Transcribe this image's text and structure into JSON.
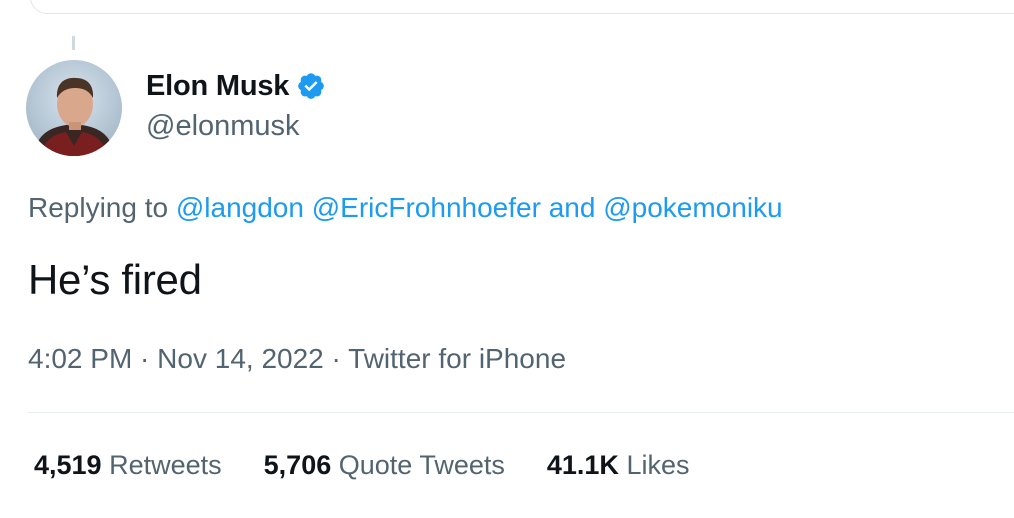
{
  "author": {
    "display_name": "Elon Musk",
    "handle": "@elonmusk",
    "verified": true
  },
  "reply_context": {
    "prefix": "Replying to ",
    "mentions": [
      "@langdon",
      "@EricFrohnhoefer",
      "@pokemoniku"
    ],
    "separator_space": " ",
    "conjunction": " and "
  },
  "tweet": {
    "text": "He’s fired"
  },
  "meta": {
    "time": "4:02 PM",
    "separator": " · ",
    "date": "Nov 14, 2022",
    "source": "Twitter for iPhone"
  },
  "stats": [
    {
      "count": "4,519",
      "label": "Retweets"
    },
    {
      "count": "5,706",
      "label": "Quote Tweets"
    },
    {
      "count": "41.1K",
      "label": "Likes"
    }
  ],
  "colors": {
    "accent": "#1d9bf0",
    "secondary_text": "#536471",
    "primary_text": "#0f1419"
  },
  "icons": {
    "verified": "verified-badge-icon",
    "avatar": "profile-photo"
  }
}
